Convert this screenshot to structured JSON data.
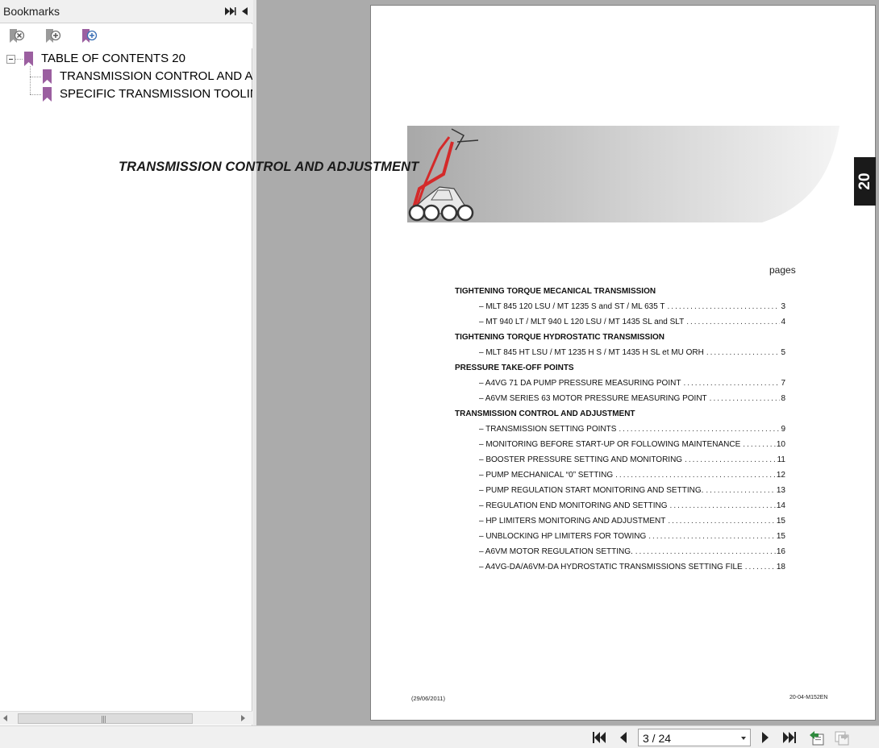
{
  "bookmarks": {
    "title": "Bookmarks",
    "tree": {
      "root": "TABLE OF CONTENTS 20",
      "children": [
        "TRANSMISSION CONTROL AND ADJUSTMENT",
        "SPECIFIC TRANSMISSION TOOLING"
      ]
    }
  },
  "document": {
    "banner_title": "TRANSMISSION CONTROL AND ADJUSTMENT",
    "side_tab": "20",
    "pages_label": "pages",
    "sections": [
      {
        "heading": "TIGHTENING TORQUE MECANICAL TRANSMISSION",
        "items": [
          {
            "text": "– MLT 845 120 LSU / MT 1235 S and ST / ML 635 T",
            "page": "3"
          },
          {
            "text": "– MT 940 LT / MLT 940 L 120 LSU / MT 1435 SL and SLT",
            "page": "4"
          }
        ]
      },
      {
        "heading": "TIGHTENING TORQUE HYDROSTATIC TRANSMISSION",
        "items": [
          {
            "text": "– MLT 845 HT LSU / MT 1235 H S / MT 1435 H SL et MU ORH",
            "page": "5"
          }
        ]
      },
      {
        "heading": "PRESSURE TAKE-OFF POINTS",
        "items": [
          {
            "text": "– A4VG 71 DA PUMP PRESSURE MEASURING POINT",
            "page": "7"
          },
          {
            "text": "– A6VM SERIES 63 MOTOR PRESSURE MEASURING POINT",
            "page": "8"
          }
        ]
      },
      {
        "heading": "TRANSMISSION CONTROL AND ADJUSTMENT",
        "items": [
          {
            "text": "– TRANSMISSION SETTING POINTS",
            "page": "9"
          },
          {
            "text": "– MONITORING BEFORE START-UP OR FOLLOWING MAINTENANCE",
            "page": "10"
          },
          {
            "text": "– BOOSTER PRESSURE SETTING AND MONITORING",
            "page": "11"
          },
          {
            "text": "– PUMP MECHANICAL “0” SETTING",
            "page": "12"
          },
          {
            "text": "– PUMP REGULATION START MONITORING AND SETTING.",
            "page": "13"
          },
          {
            "text": "– REGULATION END MONITORING AND SETTING",
            "page": "14"
          },
          {
            "text": "– HP LIMITERS MONITORING AND ADJUSTMENT",
            "page": "15"
          },
          {
            "text": "– UNBLOCKING HP LIMITERS FOR TOWING",
            "page": "15"
          },
          {
            "text": "– A6VM MOTOR REGULATION SETTING.",
            "page": "16"
          },
          {
            "text": "– A4VG-DA/A6VM-DA HYDROSTATIC TRANSMISSIONS SETTING FILE",
            "page": "18"
          }
        ]
      }
    ],
    "footer_date": "(29/06/2011)",
    "footer_code": "20-04-M152EN"
  },
  "navigation": {
    "page_indicator": "3 / 24"
  },
  "colors": {
    "bookmark_flag": "#9b5fa0",
    "viewer_bg": "#ababab",
    "machine_red": "#d42a2a"
  },
  "icons": {
    "toolbar": [
      "delete-bookmark-icon",
      "new-bookmark-icon",
      "expand-bookmark-icon"
    ],
    "nav": [
      "first-page-icon",
      "previous-page-icon",
      "next-page-icon",
      "last-page-icon",
      "previous-view-icon",
      "next-view-icon"
    ]
  }
}
